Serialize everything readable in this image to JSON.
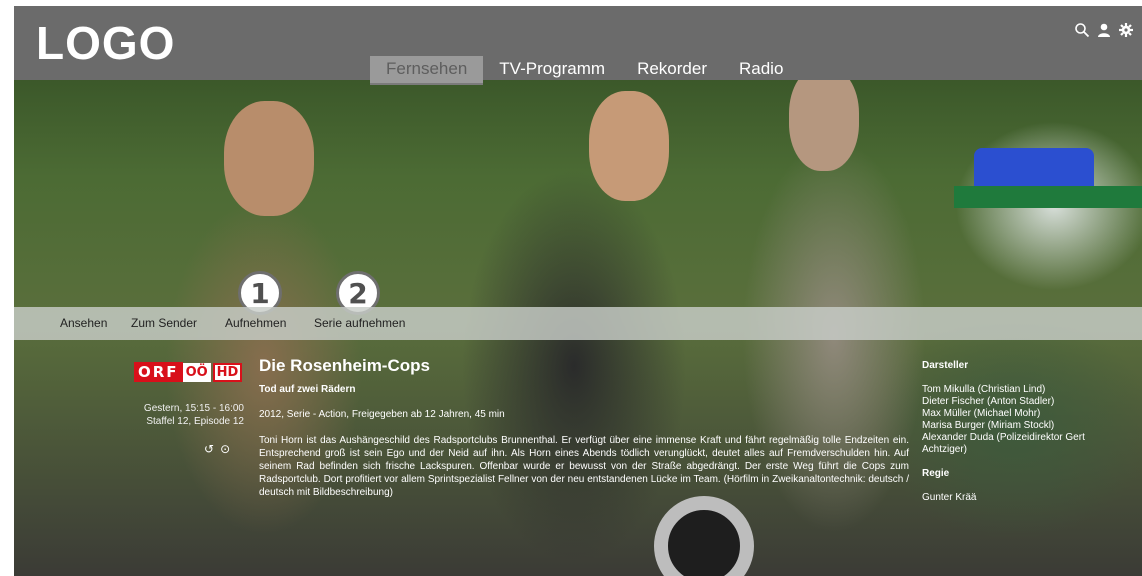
{
  "header": {
    "logo": "LOGO",
    "nav": [
      "Fernsehen",
      "TV-Programm",
      "Rekorder",
      "Radio"
    ],
    "active_tab": "Fernsehen",
    "icons": [
      "search-icon",
      "user-icon",
      "gear-icon"
    ]
  },
  "actions": {
    "items": [
      "Ansehen",
      "Zum Sender",
      "Aufnehmen",
      "Serie aufnehmen"
    ],
    "badges": [
      "1",
      "2"
    ]
  },
  "program": {
    "channel": {
      "orf": "ORF",
      "region": "OÖ",
      "hd": "HD"
    },
    "time": "Gestern, 15:15 - 16:00",
    "season_episode": "Staffel 12, Episode 12",
    "title": "Die Rosenheim-Cops",
    "episode_title": "Tod auf zwei Rädern",
    "meta": "2012, Serie - Action, Freigegeben ab 12 Jahren, 45 min",
    "description": "Toni Horn ist das Aushängeschild des Radsportclubs Brunnenthal. Er verfügt über eine immense Kraft und fährt regelmäßig tolle Endzeiten ein. Entsprechend groß ist sein Ego und der Neid auf ihn. Als Horn eines Abends tödlich verunglückt, deutet alles auf Fremdverschulden hin. Auf seinem Rad befinden sich frische Lackspuren. Offenbar wurde er bewusst von der Straße abgedrängt. Der erste Weg führt die Cops zum Radsportclub. Dort profitiert vor allem Sprintspezialist Fellner von der neu entstandenen Lücke im Team. (Hörfilm in Zweikanaltontechnik: deutsch / deutsch mit Bildbeschreibung)"
  },
  "credits": {
    "cast_label": "Darsteller",
    "cast": [
      "Tom Mikulla (Christian Lind)",
      "Dieter Fischer (Anton Stadler)",
      "Max Müller (Michael Mohr)",
      "Marisa Burger (Miriam Stockl)",
      "Alexander Duda (Polizeidirektor Gert Achtziger)"
    ],
    "director_label": "Regie",
    "director": "Gunter Krää"
  }
}
